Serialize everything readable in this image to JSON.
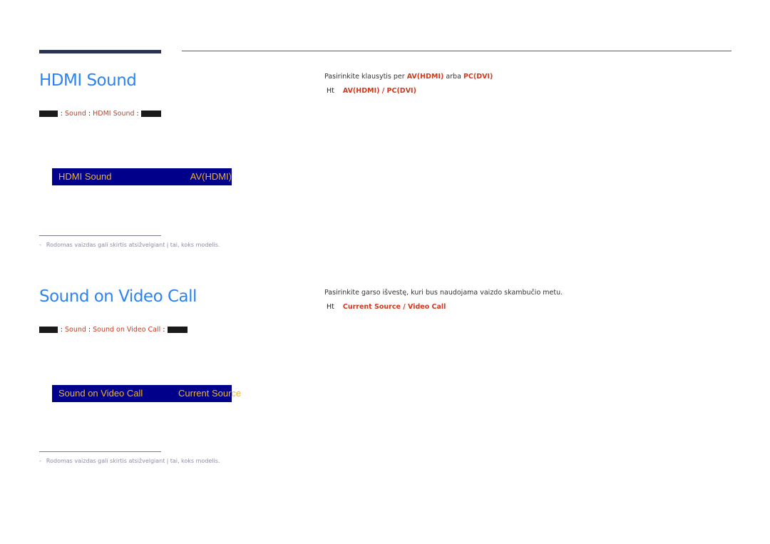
{
  "sections": [
    {
      "title": "HDMI Sound",
      "title_rendered": "Sound",
      "menu_path": {
        "prefix": "MENU",
        "items": [
          "Sound",
          "HDMI Sound"
        ],
        "suffix": "ENTER"
      },
      "osd": {
        "label": "HDMI Sound",
        "value": "AV(HDMI)"
      },
      "footnote": {
        "dash": "-",
        "text": "Rodomas vaizdas gali skirtis atsižvelgiant į tai, koks modelis."
      },
      "description": {
        "text": "Pasirinkite klausytis per",
        "option_a": "AV(HDMI)",
        "joiner": "arba",
        "option_b": "PC(DVI)"
      },
      "options_line": {
        "label": "Ht",
        "value": "AV(HDMI) / PC(DVI)"
      }
    },
    {
      "title": "Sound on Video Call",
      "menu_path": {
        "prefix": "MENU",
        "items": [
          "Sound",
          "Sound on Video Call"
        ],
        "suffix": "ENTER"
      },
      "osd": {
        "label": "Sound on Video Call",
        "value": "Current Source"
      },
      "footnote": {
        "dash": "-",
        "text": "Rodomas vaizdas gali skirtis atsižvelgiant į tai, koks modelis."
      },
      "description": {
        "text": "Pasirinkite garso išvestę, kuri bus naudojama vaizdo skambučio metu."
      },
      "options_line": {
        "label": "Ht",
        "value": "Current Source / Video Call"
      }
    }
  ],
  "colors": {
    "title_blue": "#2c84f2",
    "menu_red": "#d0391c",
    "osd_background": "#00008b",
    "osd_text": "#f0b429",
    "rule_dark": "#2b3350"
  }
}
